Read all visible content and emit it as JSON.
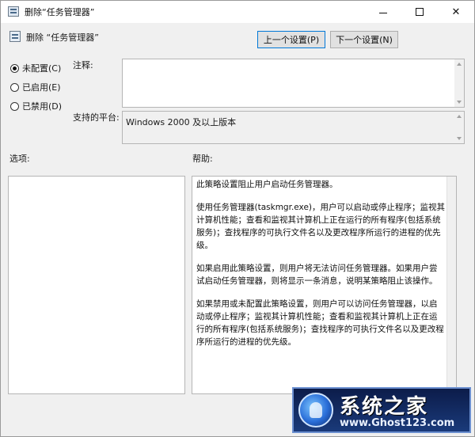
{
  "window": {
    "title": "删除“任务管理器”",
    "minimize": "—",
    "maximize": "□",
    "close": "✕"
  },
  "header": {
    "title": "删除 “任务管理器”",
    "prev_button": "上一个设置(P)",
    "next_button": "下一个设置(N)"
  },
  "state": {
    "options": [
      {
        "label": "未配置(C)",
        "checked": true
      },
      {
        "label": "已启用(E)",
        "checked": false
      },
      {
        "label": "已禁用(D)",
        "checked": false
      }
    ]
  },
  "comment": {
    "label": "注释:",
    "value": ""
  },
  "platform": {
    "label": "支持的平台:",
    "value": "Windows 2000 及以上版本"
  },
  "options_panel": {
    "label": "选项:"
  },
  "help_panel": {
    "label": "帮助:",
    "paragraphs": [
      "此策略设置阻止用户启动任务管理器。",
      "使用任务管理器(taskmgr.exe)，用户可以启动或停止程序；监视其计算机性能；查看和监视其计算机上正在运行的所有程序(包括系统服务)；查找程序的可执行文件名以及更改程序所运行的进程的优先级。",
      "如果启用此策略设置，则用户将无法访问任务管理器。如果用户尝试启动任务管理器，则将显示一条消息，说明某策略阻止该操作。",
      "如果禁用或未配置此策略设置，则用户可以访问任务管理器，以启动或停止程序；监视其计算机性能；查看和监视其计算机上正在运行的所有程序(包括系统服务)；查找程序的可执行文件名以及更改程序所运行的进程的优先级。"
    ]
  },
  "watermark": {
    "title": "系统之家",
    "url": "www.Ghost123.com"
  }
}
